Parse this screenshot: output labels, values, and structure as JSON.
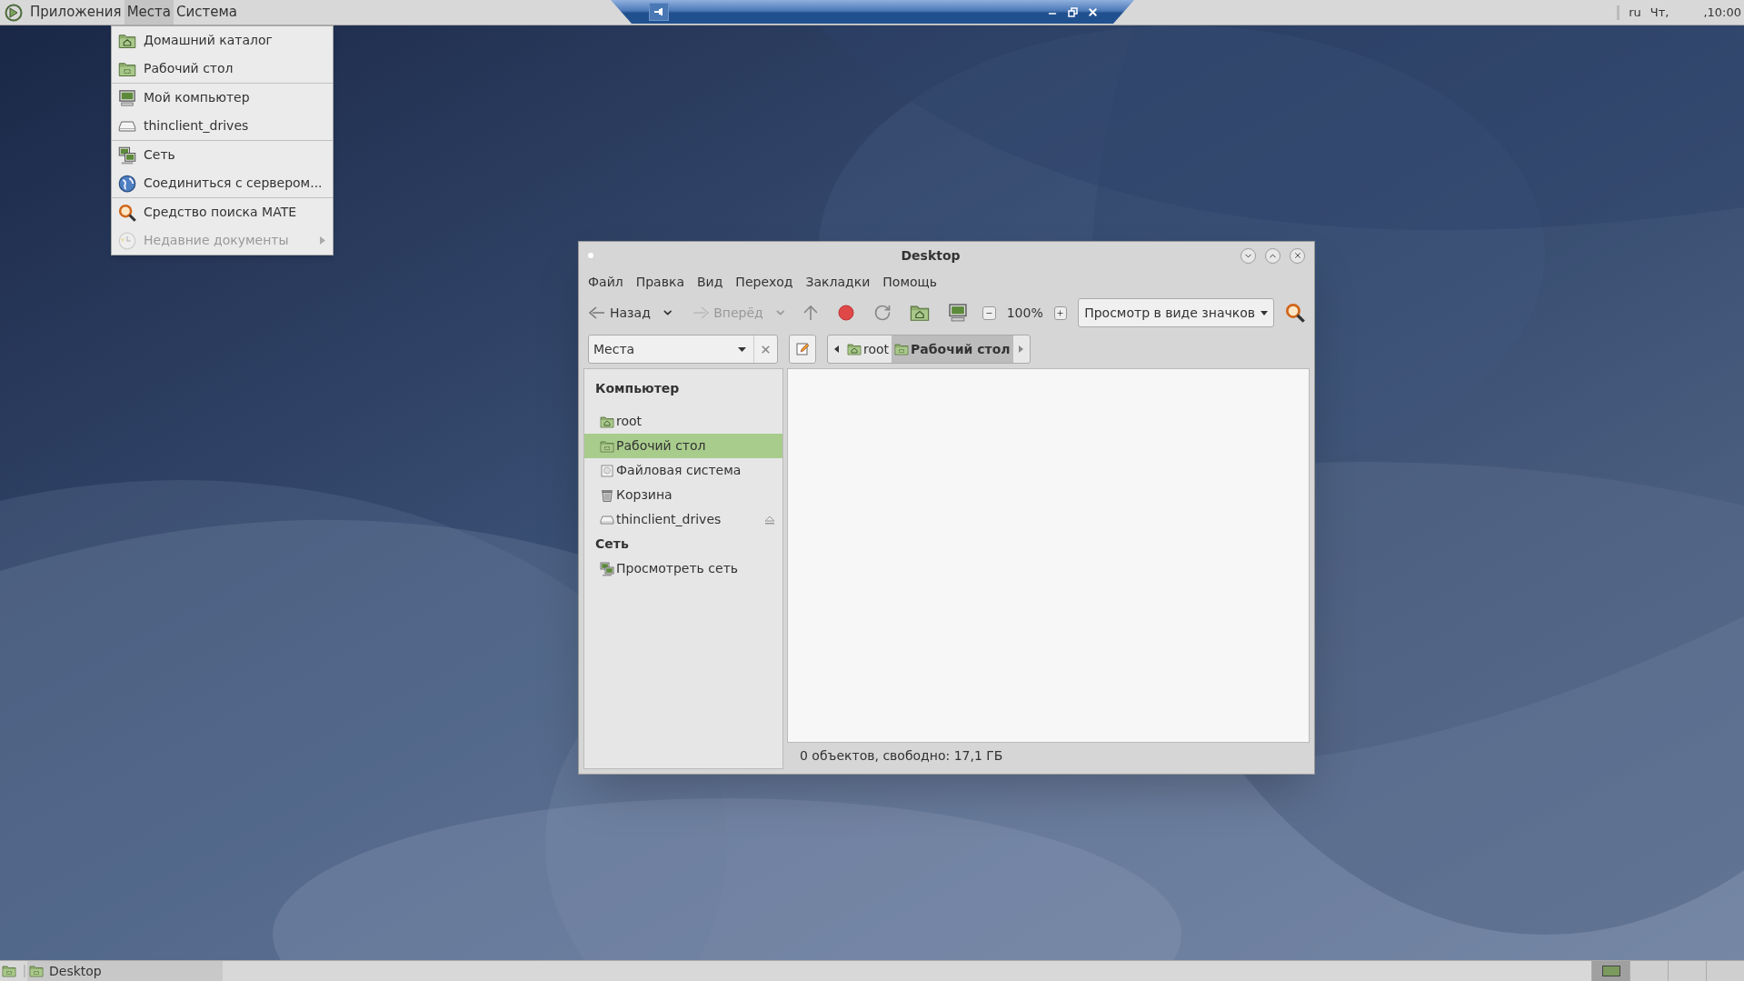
{
  "top_panel": {
    "menus": [
      {
        "label": "Приложения",
        "selected": false
      },
      {
        "label": "Места",
        "selected": true
      },
      {
        "label": "Система",
        "selected": false
      }
    ],
    "language": "ru",
    "day": "Чт,",
    "time": ",10:00"
  },
  "places_menu": {
    "sections": [
      {
        "items": [
          {
            "label": "Домашний каталог",
            "kind": "home",
            "disabled": false,
            "has_submenu": false
          },
          {
            "label": "Рабочий стол",
            "kind": "desktop",
            "disabled": false,
            "has_submenu": false
          }
        ]
      },
      {
        "items": [
          {
            "label": "Мой компьютер",
            "kind": "computer",
            "disabled": false,
            "has_submenu": false
          },
          {
            "label": "thinclient_drives",
            "kind": "drive",
            "disabled": false,
            "has_submenu": false
          }
        ]
      },
      {
        "items": [
          {
            "label": "Сеть",
            "kind": "network",
            "disabled": false,
            "has_submenu": false
          },
          {
            "label": "Соединиться с сервером...",
            "kind": "globe",
            "disabled": false,
            "has_submenu": false
          }
        ]
      },
      {
        "items": [
          {
            "label": "Средство поиска MATE",
            "kind": "search",
            "disabled": false,
            "has_submenu": false
          },
          {
            "label": "Недавние документы",
            "kind": "recent",
            "disabled": true,
            "has_submenu": true
          }
        ]
      }
    ]
  },
  "window": {
    "title": "Desktop",
    "menu": [
      "Файл",
      "Правка",
      "Вид",
      "Переход",
      "Закладки",
      "Помощь"
    ],
    "toolbar": {
      "back": {
        "label": "Назад",
        "disabled": false
      },
      "forward": {
        "label": "Вперёд",
        "disabled": true
      },
      "zoom": "100%",
      "view_mode": "Просмотр в виде значков"
    },
    "location": {
      "places_combo": "Места",
      "path": [
        {
          "label": "root",
          "selected": false
        },
        {
          "label": "Рабочий стол",
          "selected": true
        }
      ]
    },
    "sidebar": {
      "sections": [
        {
          "title": "Компьютер",
          "items": [
            {
              "label": "root",
              "kind": "home",
              "selected": false,
              "ejectable": false
            },
            {
              "label": "Рабочий стол",
              "kind": "desktop",
              "selected": true,
              "ejectable": false
            },
            {
              "label": "Файловая система",
              "kind": "filesystem",
              "selected": false,
              "ejectable": false
            },
            {
              "label": "Корзина",
              "kind": "trash",
              "selected": false,
              "ejectable": false
            },
            {
              "label": "thinclient_drives",
              "kind": "drive",
              "selected": false,
              "ejectable": true
            }
          ]
        },
        {
          "title": "Сеть",
          "items": [
            {
              "label": "Просмотреть сеть",
              "kind": "network",
              "selected": false,
              "ejectable": false
            }
          ]
        }
      ]
    },
    "status": "0 объектов, свободно: 17,1 ГБ"
  },
  "taskbar": {
    "tasks": [
      {
        "label": "Desktop"
      }
    ],
    "workspaces": [
      {
        "selected": true
      },
      {
        "selected": false
      },
      {
        "selected": false
      },
      {
        "selected": false
      }
    ]
  }
}
